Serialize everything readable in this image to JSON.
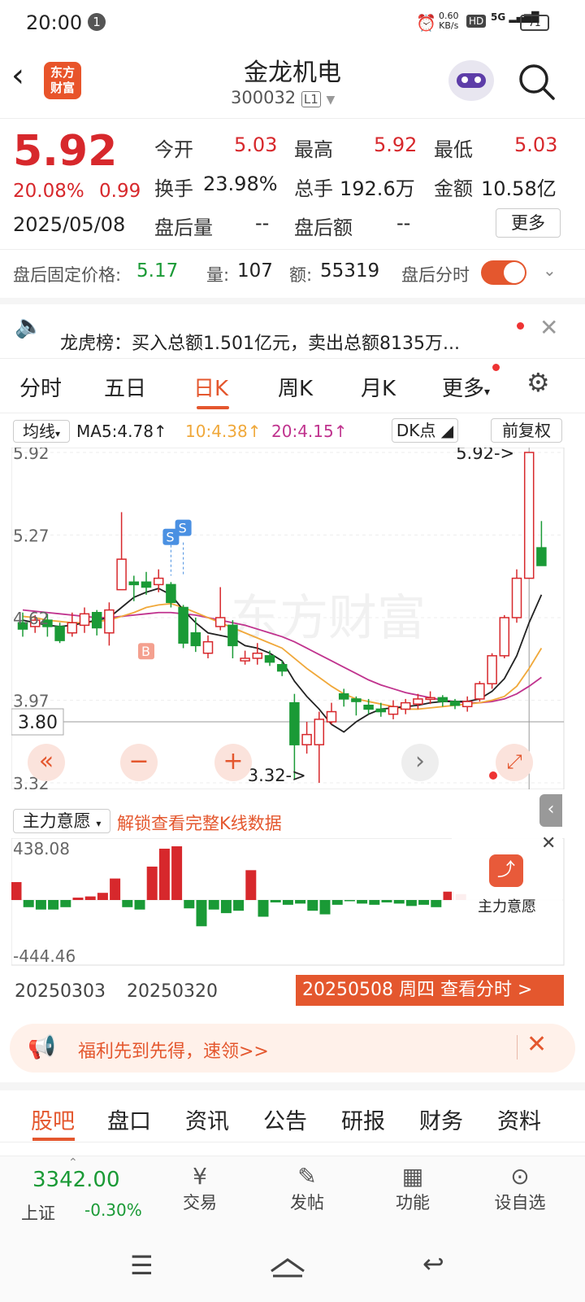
{
  "status_bar": {
    "time": "20:00",
    "notif_count": "1",
    "net_speed_top": "0.60",
    "net_speed_unit": "KB/s",
    "hd": "HD",
    "signal": "5G",
    "battery": "71"
  },
  "header": {
    "back_icon": "back-arrow-icon",
    "logo_line1": "东方",
    "logo_line2": "财富",
    "stock_name": "金龙机电",
    "stock_code": "300032",
    "level": "L1"
  },
  "quote": {
    "price": "5.92",
    "change_pct": "20.08%",
    "change_amt": "0.99",
    "date": "2025/05/08",
    "open_label": "今开",
    "open": "5.03",
    "high_label": "最高",
    "high": "5.92",
    "low_label": "最低",
    "low": "5.03",
    "turnover_label": "换手",
    "turnover": "23.98%",
    "volume_label": "总手",
    "volume": "192.6万",
    "amount_label": "金额",
    "amount": "10.58亿",
    "ah_vol_label": "盘后量",
    "ah_vol": "--",
    "ah_amt_label": "盘后额",
    "ah_amt": "--",
    "more_button": "更多",
    "fixed_price_label": "盘后固定价格:",
    "fixed_price": "5.17",
    "qty_label": "量:",
    "qty": "107",
    "amt_label": "额:",
    "amt": "55319",
    "ah_fenshi_label": "盘后分时"
  },
  "notice": {
    "text": "龙虎榜：买入总额1.501亿元，卖出总额8135万..."
  },
  "kline_tabs": [
    "分时",
    "五日",
    "日K",
    "周K",
    "月K",
    "更多"
  ],
  "ma_row": {
    "label": "均线",
    "ma5": "MA5:4.78↑",
    "ma10": "10:4.38↑",
    "ma20": "20:4.15↑",
    "dk": "DK点",
    "fq": "前复权"
  },
  "chart_data": {
    "type": "candlestick",
    "y_labels": [
      "5.92",
      "5.27",
      "4.62",
      "3.97",
      "3.32"
    ],
    "ylim": [
      3.32,
      5.92
    ],
    "current_line": "3.80",
    "max_marker": "5.92->",
    "min_marker": "3.32->",
    "marker_b": "B",
    "marker_s": "S",
    "watermark": "东方财富",
    "candles": [
      {
        "o": 4.58,
        "c": 4.53,
        "h": 4.66,
        "l": 4.47
      },
      {
        "o": 4.55,
        "c": 4.6,
        "h": 4.64,
        "l": 4.5
      },
      {
        "o": 4.6,
        "c": 4.55,
        "h": 4.65,
        "l": 4.47
      },
      {
        "o": 4.55,
        "c": 4.44,
        "h": 4.58,
        "l": 4.42
      },
      {
        "o": 4.5,
        "c": 4.58,
        "h": 4.66,
        "l": 4.47
      },
      {
        "o": 4.56,
        "c": 4.65,
        "h": 4.7,
        "l": 4.5
      },
      {
        "o": 4.66,
        "c": 4.54,
        "h": 4.68,
        "l": 4.48
      },
      {
        "o": 4.5,
        "c": 4.68,
        "h": 4.74,
        "l": 4.4
      },
      {
        "o": 4.84,
        "c": 5.08,
        "h": 5.45,
        "l": 4.84
      },
      {
        "o": 4.9,
        "c": 4.88,
        "h": 4.95,
        "l": 4.75
      },
      {
        "o": 4.9,
        "c": 4.86,
        "h": 4.98,
        "l": 4.8
      },
      {
        "o": 4.88,
        "c": 4.93,
        "h": 5.0,
        "l": 4.82
      },
      {
        "o": 4.88,
        "c": 4.74,
        "h": 4.9,
        "l": 4.7
      },
      {
        "o": 4.7,
        "c": 4.42,
        "h": 4.72,
        "l": 4.38
      },
      {
        "o": 4.5,
        "c": 4.4,
        "h": 4.62,
        "l": 4.35
      },
      {
        "o": 4.34,
        "c": 4.43,
        "h": 4.48,
        "l": 4.3
      },
      {
        "o": 4.55,
        "c": 4.62,
        "h": 4.86,
        "l": 4.52
      },
      {
        "o": 4.56,
        "c": 4.4,
        "h": 4.6,
        "l": 4.3
      },
      {
        "o": 4.28,
        "c": 4.3,
        "h": 4.36,
        "l": 4.25
      },
      {
        "o": 4.3,
        "c": 4.34,
        "h": 4.42,
        "l": 4.25
      },
      {
        "o": 4.32,
        "c": 4.27,
        "h": 4.36,
        "l": 4.24
      },
      {
        "o": 4.25,
        "c": 4.2,
        "h": 4.28,
        "l": 4.16
      },
      {
        "o": 3.95,
        "c": 3.62,
        "h": 4.02,
        "l": 3.35
      },
      {
        "o": 3.62,
        "c": 3.7,
        "h": 3.8,
        "l": 3.55
      },
      {
        "o": 3.62,
        "c": 3.82,
        "h": 3.88,
        "l": 3.32
      },
      {
        "o": 3.8,
        "c": 3.88,
        "h": 3.95,
        "l": 3.78
      },
      {
        "o": 4.02,
        "c": 3.98,
        "h": 4.06,
        "l": 3.92
      },
      {
        "o": 3.98,
        "c": 3.96,
        "h": 4.0,
        "l": 3.85
      },
      {
        "o": 3.93,
        "c": 3.9,
        "h": 3.98,
        "l": 3.86
      },
      {
        "o": 3.9,
        "c": 3.88,
        "h": 3.95,
        "l": 3.84
      },
      {
        "o": 3.86,
        "c": 3.92,
        "h": 3.97,
        "l": 3.82
      },
      {
        "o": 3.9,
        "c": 3.95,
        "h": 3.98,
        "l": 3.86
      },
      {
        "o": 3.94,
        "c": 3.98,
        "h": 4.02,
        "l": 3.9
      },
      {
        "o": 3.98,
        "c": 3.99,
        "h": 4.04,
        "l": 3.94
      },
      {
        "o": 3.99,
        "c": 3.96,
        "h": 4.01,
        "l": 3.92
      },
      {
        "o": 3.96,
        "c": 3.93,
        "h": 3.98,
        "l": 3.9
      },
      {
        "o": 3.92,
        "c": 3.96,
        "h": 4.0,
        "l": 3.88
      },
      {
        "o": 3.98,
        "c": 4.1,
        "h": 4.12,
        "l": 3.96
      },
      {
        "o": 4.1,
        "c": 4.32,
        "h": 4.34,
        "l": 4.06
      },
      {
        "o": 4.32,
        "c": 4.62,
        "h": 4.64,
        "l": 4.3
      },
      {
        "o": 4.62,
        "c": 4.93,
        "h": 5.0,
        "l": 4.58
      },
      {
        "o": 4.93,
        "c": 5.92,
        "h": 5.92,
        "l": 4.93
      },
      {
        "o": 5.17,
        "c": 5.03,
        "h": 5.38,
        "l": 5.03
      }
    ],
    "ma5": [
      4.6,
      4.58,
      4.56,
      4.55,
      4.56,
      4.58,
      4.6,
      4.62,
      4.7,
      4.78,
      4.82,
      4.85,
      4.8,
      4.68,
      4.58,
      4.5,
      4.48,
      4.46,
      4.4,
      4.38,
      4.34,
      4.28,
      4.12,
      4.0,
      3.9,
      3.78,
      3.72,
      3.8,
      3.86,
      3.9,
      3.91,
      3.92,
      3.93,
      3.95,
      3.96,
      3.96,
      3.96,
      3.98,
      4.04,
      4.14,
      4.32,
      4.58,
      4.8
    ],
    "ma10": [
      4.63,
      4.62,
      4.6,
      4.59,
      4.58,
      4.58,
      4.59,
      4.6,
      4.63,
      4.66,
      4.7,
      4.72,
      4.73,
      4.7,
      4.66,
      4.62,
      4.58,
      4.54,
      4.5,
      4.46,
      4.42,
      4.38,
      4.3,
      4.22,
      4.15,
      4.08,
      4.02,
      3.98,
      3.96,
      3.94,
      3.92,
      3.9,
      3.9,
      3.91,
      3.92,
      3.93,
      3.94,
      3.95,
      3.97,
      4.0,
      4.08,
      4.22,
      4.38
    ],
    "ma20": [
      4.68,
      4.67,
      4.66,
      4.65,
      4.64,
      4.63,
      4.62,
      4.62,
      4.63,
      4.64,
      4.65,
      4.66,
      4.66,
      4.65,
      4.64,
      4.62,
      4.6,
      4.58,
      4.56,
      4.53,
      4.5,
      4.47,
      4.43,
      4.38,
      4.33,
      4.28,
      4.23,
      4.18,
      4.13,
      4.09,
      4.06,
      4.03,
      4.01,
      3.99,
      3.97,
      3.96,
      3.95,
      3.95,
      3.96,
      3.98,
      4.02,
      4.08,
      4.15
    ]
  },
  "indicator": {
    "label": "主力意愿",
    "unlock_text": "解锁查看完整K线数据",
    "max_label": "438.08",
    "min_label": "-444.46",
    "bars": [
      150,
      -60,
      -80,
      -80,
      -60,
      20,
      30,
      60,
      180,
      -60,
      -80,
      280,
      430,
      450,
      -70,
      -220,
      -80,
      -110,
      -90,
      250,
      -140,
      -20,
      -40,
      -30,
      -90,
      -120,
      -40,
      -10,
      -30,
      -40,
      -20,
      -30,
      -50,
      -40,
      -60,
      70,
      50
    ],
    "float_label": "主力意愿"
  },
  "dates": {
    "d1": "20250303",
    "d2": "20250320",
    "current": "20250508 周四  查看分时 >"
  },
  "promo": {
    "text": "福利先到先得，速领>>"
  },
  "bottom_tabs": [
    "股吧",
    "盘口",
    "资讯",
    "公告",
    "研报",
    "财务",
    "资料"
  ],
  "toolbar": {
    "index_value": "3342.00",
    "index_name": "上证",
    "index_change": "-0.30%",
    "trade": "交易",
    "post": "发帖",
    "func": "功能",
    "watch": "设自选"
  },
  "colors": {
    "up": "#d7282c",
    "down": "#1a9a36",
    "ma5": "#222222",
    "ma10": "#f0a83a",
    "ma20": "#c0338e",
    "accent": "#e4572e"
  }
}
